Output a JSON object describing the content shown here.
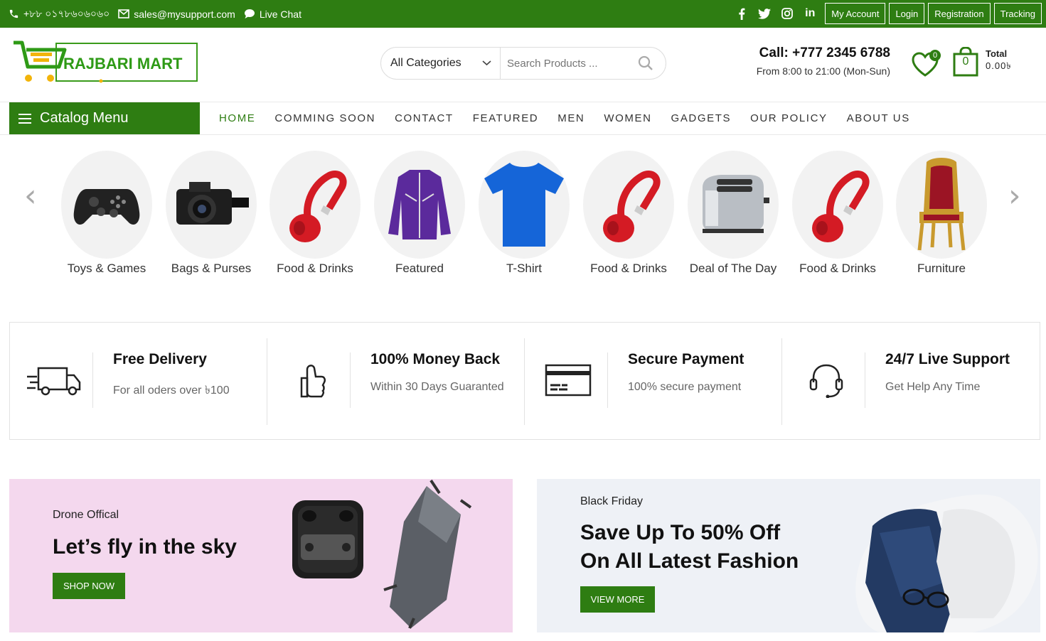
{
  "topbar": {
    "phone": "+৮৮ ০১৭৮৬০৬০৬০",
    "email": "sales@mysupport.com",
    "live_chat": "Live Chat",
    "social": [
      "facebook-icon",
      "twitter-icon",
      "instagram-icon",
      "linkedin-icon"
    ],
    "linkedin_text": "in",
    "buttons": [
      "My Account",
      "Login",
      "Registration",
      "Tracking"
    ]
  },
  "header": {
    "logo_text": "RAJBARI MART",
    "category_select": "All Categories",
    "search_placeholder": "Search Products ...",
    "call_title": "Call: +777 2345 6788",
    "call_hours": "From 8:00 to 21:00 (Mon-Sun)",
    "wishlist_count": "0",
    "cart_count": "0",
    "cart_total_label": "Total",
    "cart_total_value": "0.00৳"
  },
  "nav": {
    "catalog_label": "Catalog Menu",
    "items": [
      "HOME",
      "COMMING SOON",
      "CONTACT",
      "FEATURED",
      "MEN",
      "WOMEN",
      "GADGETS",
      "OUR POLICY",
      "ABOUT US"
    ],
    "active": "HOME"
  },
  "categories": {
    "prev_arrow": "‹",
    "next_arrow": "›",
    "items": [
      {
        "label": "Toys & Games",
        "icon": "gamepad-icon"
      },
      {
        "label": "Bags & Purses",
        "icon": "camera-icon"
      },
      {
        "label": "Food & Drinks",
        "icon": "headphones-icon"
      },
      {
        "label": "Featured",
        "icon": "jacket-icon"
      },
      {
        "label": "T-Shirt",
        "icon": "tshirt-icon"
      },
      {
        "label": "Food & Drinks",
        "icon": "headphones-icon"
      },
      {
        "label": "Deal of The Day",
        "icon": "toaster-icon"
      },
      {
        "label": "Food & Drinks",
        "icon": "headphones-icon"
      },
      {
        "label": "Furniture",
        "icon": "chair-icon"
      }
    ]
  },
  "features": [
    {
      "title": "Free Delivery",
      "sub": "For all oders over ৳100",
      "icon": "truck-icon"
    },
    {
      "title": "100% Money Back",
      "sub": "Within 30 Days Guaranted",
      "icon": "thumbs-up-icon"
    },
    {
      "title": "Secure Payment",
      "sub": "100% secure payment",
      "icon": "credit-card-icon"
    },
    {
      "title": "24/7 Live Support",
      "sub": "Get Help Any Time",
      "icon": "headset-icon"
    }
  ],
  "banners": {
    "left": {
      "small": "Drone Offical",
      "big": "Let’s fly in the sky",
      "button": "SHOP NOW"
    },
    "right": {
      "small": "Black Friday",
      "big_line1": "Save Up To 50% Off",
      "big_line2": "On All Latest Fashion",
      "button": "VIEW MORE"
    }
  },
  "colors": {
    "brand_green": "#2e7d12",
    "left_banner_bg": "#f4d8ee",
    "right_banner_bg": "#eef1f6"
  }
}
